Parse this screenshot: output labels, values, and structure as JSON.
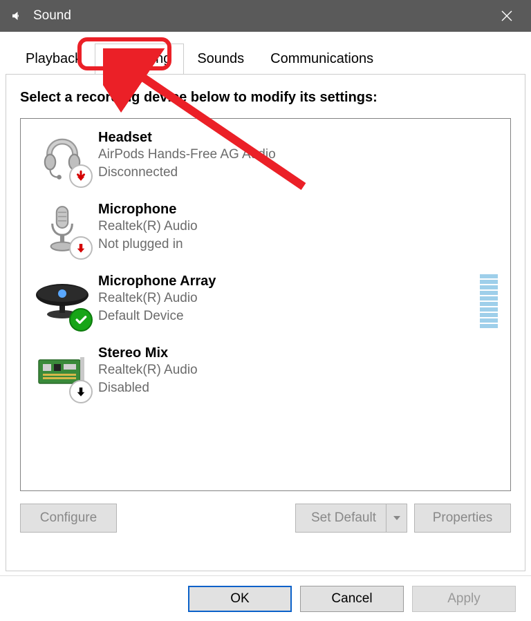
{
  "window": {
    "title": "Sound"
  },
  "tabs": {
    "items": [
      {
        "label": "Playback"
      },
      {
        "label": "Recording"
      },
      {
        "label": "Sounds"
      },
      {
        "label": "Communications"
      }
    ],
    "active_index": 1
  },
  "instruction": "Select a recording device below to modify its settings:",
  "devices": [
    {
      "name": "Headset",
      "line2": "AirPods Hands-Free AG Audio",
      "line3": "Disconnected",
      "icon": "headset",
      "badge": "down-red"
    },
    {
      "name": "Microphone",
      "line2": "Realtek(R) Audio",
      "line3": "Not plugged in",
      "icon": "mic",
      "badge": "down-red"
    },
    {
      "name": "Microphone Array",
      "line2": "Realtek(R) Audio",
      "line3": "Default Device",
      "icon": "webcam",
      "badge": "check",
      "meter": true
    },
    {
      "name": "Stereo Mix",
      "line2": "Realtek(R) Audio",
      "line3": "Disabled",
      "icon": "card",
      "badge": "down-black"
    }
  ],
  "buttons": {
    "configure": "Configure",
    "set_default": "Set Default",
    "properties": "Properties",
    "ok": "OK",
    "cancel": "Cancel",
    "apply": "Apply"
  }
}
